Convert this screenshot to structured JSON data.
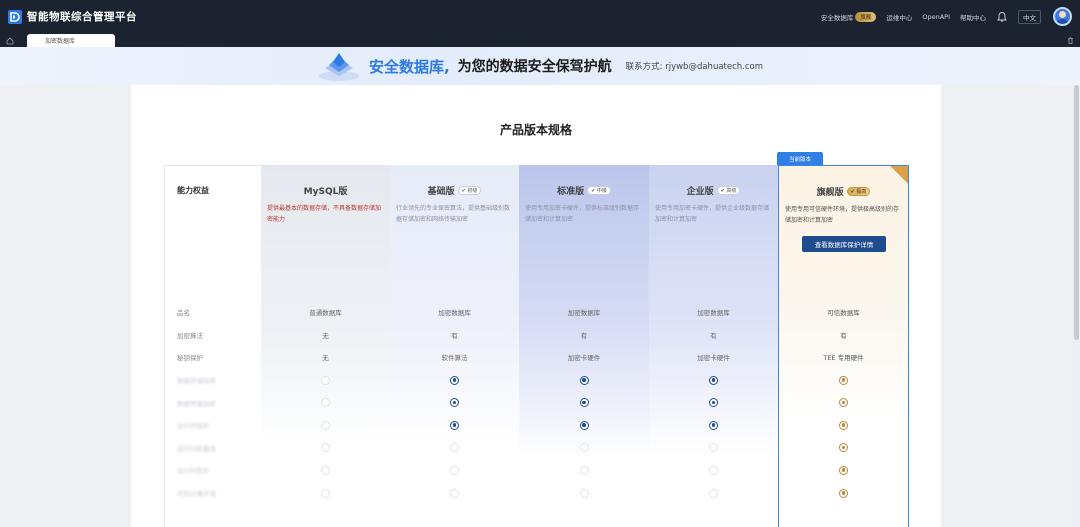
{
  "app": {
    "title": "智能物联综合管理平台"
  },
  "topbar": {
    "secure_db_label": "安全数据库",
    "secure_db_badge": "旗舰",
    "ops_center": "运维中心",
    "open_api": "OpenAPI",
    "help_center": "帮助中心",
    "language": "中文"
  },
  "tabs": {
    "active": "加密数据库"
  },
  "banner": {
    "highlight": "安全数据库,",
    "text": "为您的数据安全保驾护航",
    "contact": "联系方式: rjywb@dahuatech.com"
  },
  "section": {
    "title": "产品版本规格"
  },
  "current_tag": "当前版本",
  "columns": {
    "label_header": "能力权益",
    "mysql": {
      "name": "MySQL版",
      "desc": "提供最基本的数据存储，不具备数据存储加密能力"
    },
    "basic": {
      "name": "基础版",
      "badge": "初级",
      "desc": "行业领先的专业保密算法，提供基础级别数据存储加密和网络传输加密"
    },
    "standard": {
      "name": "标准版",
      "badge": "中级",
      "desc": "使用专用加密卡硬件，提供标准级别数据存储加密和计算加密"
    },
    "enterprise": {
      "name": "企业版",
      "badge": "高级",
      "desc": "使用专用加密卡硬件，提供企业级数据存储加密和计算加密"
    },
    "flagship": {
      "name": "旗舰版",
      "badge": "极高",
      "desc": "使用专用可信硬件环境，提供极高级别的存储加密和计算加密",
      "button": "查看数据库保护详情"
    }
  },
  "rows": [
    {
      "label": "品名",
      "values": [
        "普通数据库",
        "加密数据库",
        "加密数据库",
        "加密数据库",
        "可信数据库"
      ]
    },
    {
      "label": "加密算法",
      "values": [
        "无",
        "有",
        "有",
        "有",
        "有"
      ]
    },
    {
      "label": "秘钥保护",
      "values": [
        "无",
        "软件算法",
        "加密卡硬件",
        "加密卡硬件",
        "TEE 专用硬件"
      ]
    }
  ],
  "radio_rows": [
    {
      "label": "数据存储加密",
      "states": [
        "off",
        "on",
        "on",
        "on",
        "on"
      ]
    },
    {
      "label": "数据传输加密",
      "states": [
        "off",
        "on",
        "on",
        "on",
        "on"
      ]
    },
    {
      "label": "运行时保护",
      "states": [
        "off",
        "on",
        "on",
        "on",
        "on"
      ]
    },
    {
      "label": "运行时防篡改",
      "states": [
        "off",
        "off",
        "off",
        "off",
        "on"
      ]
    },
    {
      "label": "运行时防护",
      "states": [
        "off",
        "off",
        "off",
        "off",
        "on"
      ]
    },
    {
      "label": "可信计算环境",
      "states": [
        "off",
        "off",
        "off",
        "off",
        "on"
      ]
    }
  ]
}
